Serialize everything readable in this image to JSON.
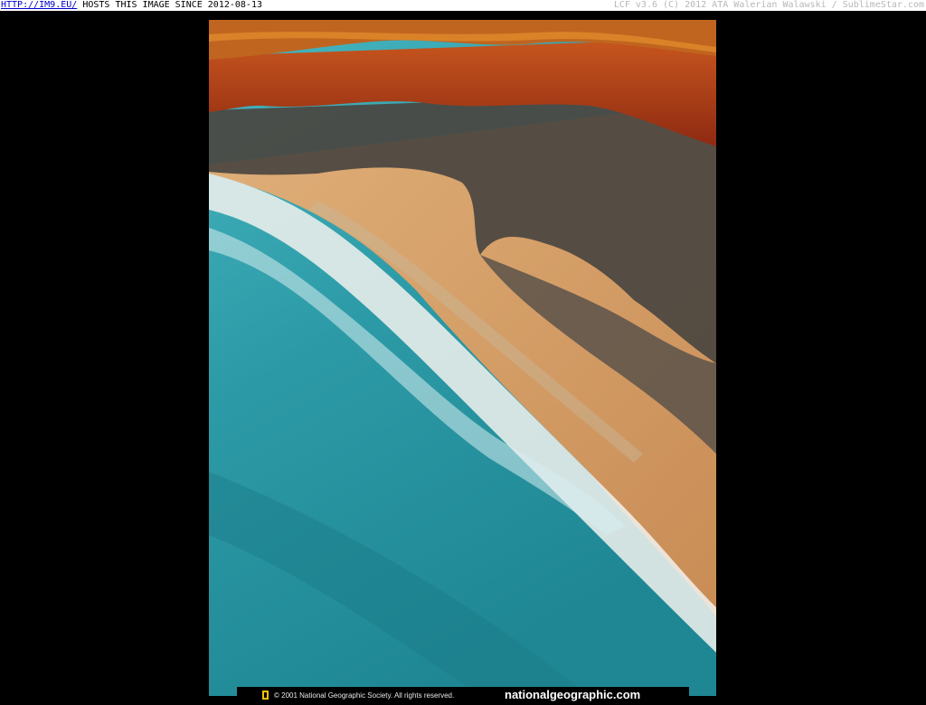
{
  "topbar": {
    "link_text": "HTTP://IM9.EU/",
    "hosts_text": " HOSTS THIS IMAGE SINCE 2012-08-13",
    "right_text": "LCF v3.6 (C) 2012 ATA Walerian Walawski / SublimeStar.com"
  },
  "photo": {
    "subject": "aerial coastline photograph"
  },
  "credit": {
    "copyright": "© 2001 National Geographic Society. All rights reserved.",
    "site": "nationalgeographic.com",
    "logo_icon": "ng-yellow-rectangle-icon",
    "logo_color": "#f2c200"
  },
  "colors": {
    "background": "#000000",
    "topbar": "#ffffff",
    "link": "#0000cc",
    "sea": "#2a9aa6",
    "sand": "#d7a266",
    "cliff": "#b4421c"
  }
}
